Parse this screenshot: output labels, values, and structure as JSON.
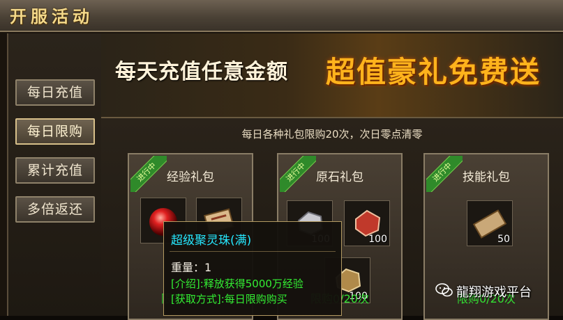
{
  "window": {
    "title": "开服活动"
  },
  "sidebar": {
    "items": [
      {
        "label": "每日充值",
        "active": false
      },
      {
        "label": "每日限购",
        "active": true
      },
      {
        "label": "累计充值",
        "active": false
      },
      {
        "label": "多倍返还",
        "active": false
      }
    ]
  },
  "banner": {
    "text_left": "每天充值任意金额",
    "text_right": "超值豪礼免费送"
  },
  "notice": "每日各种礼包限购20次，次日零点清零",
  "cards": [
    {
      "title": "经验礼包",
      "ribbon": "进行中",
      "limit": "限购0/20次",
      "items": [
        {
          "name": "red-orb",
          "count": ""
        },
        {
          "name": "scroll",
          "count": ""
        }
      ]
    },
    {
      "title": "原石礼包",
      "ribbon": "进行中",
      "limit": "限购0/20次",
      "items": [
        {
          "name": "silver-ore",
          "count": "100"
        },
        {
          "name": "red-ore",
          "count": "100"
        },
        {
          "name": "gold-ore",
          "count": "100"
        }
      ]
    },
    {
      "title": "技能礼包",
      "ribbon": "进行中",
      "limit": "限购0/20次",
      "items": [
        {
          "name": "skill-scroll",
          "count": "50"
        }
      ]
    }
  ],
  "tooltip": {
    "title": "超级聚灵珠(满)",
    "weight": "重量：1",
    "intro": "[介绍]:释放获得5000万经验",
    "obtain": "[获取方式]:每日限购购买"
  },
  "watermark": {
    "icon": "wechat-icon",
    "text": "龍翔游戏平台"
  },
  "colors": {
    "ribbon": "#2f8a2a",
    "limit": "#33e033",
    "tooltip_title": "#26e8ff",
    "banner_highlight": "#ffb31c"
  }
}
